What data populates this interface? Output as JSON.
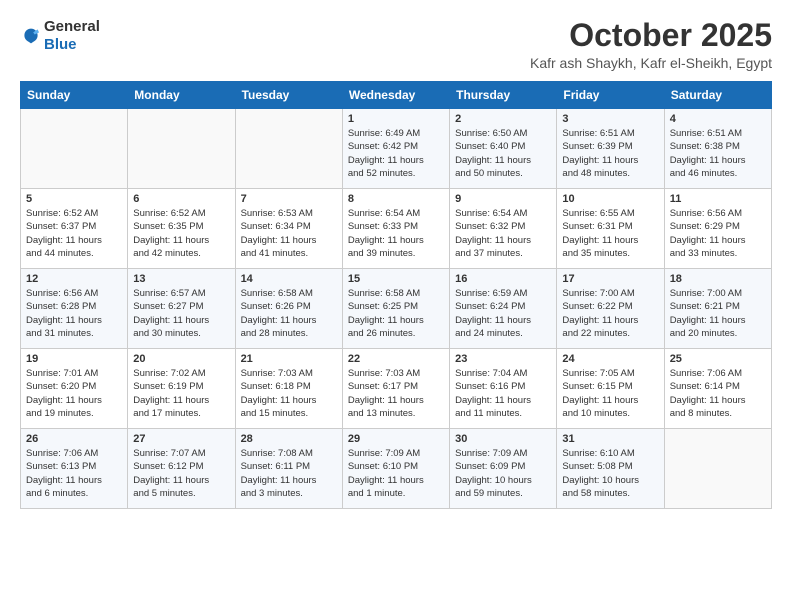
{
  "header": {
    "logo_general": "General",
    "logo_blue": "Blue",
    "month": "October 2025",
    "location": "Kafr ash Shaykh, Kafr el-Sheikh, Egypt"
  },
  "weekdays": [
    "Sunday",
    "Monday",
    "Tuesday",
    "Wednesday",
    "Thursday",
    "Friday",
    "Saturday"
  ],
  "weeks": [
    [
      {
        "day": "",
        "info": ""
      },
      {
        "day": "",
        "info": ""
      },
      {
        "day": "",
        "info": ""
      },
      {
        "day": "1",
        "info": "Sunrise: 6:49 AM\nSunset: 6:42 PM\nDaylight: 11 hours\nand 52 minutes."
      },
      {
        "day": "2",
        "info": "Sunrise: 6:50 AM\nSunset: 6:40 PM\nDaylight: 11 hours\nand 50 minutes."
      },
      {
        "day": "3",
        "info": "Sunrise: 6:51 AM\nSunset: 6:39 PM\nDaylight: 11 hours\nand 48 minutes."
      },
      {
        "day": "4",
        "info": "Sunrise: 6:51 AM\nSunset: 6:38 PM\nDaylight: 11 hours\nand 46 minutes."
      }
    ],
    [
      {
        "day": "5",
        "info": "Sunrise: 6:52 AM\nSunset: 6:37 PM\nDaylight: 11 hours\nand 44 minutes."
      },
      {
        "day": "6",
        "info": "Sunrise: 6:52 AM\nSunset: 6:35 PM\nDaylight: 11 hours\nand 42 minutes."
      },
      {
        "day": "7",
        "info": "Sunrise: 6:53 AM\nSunset: 6:34 PM\nDaylight: 11 hours\nand 41 minutes."
      },
      {
        "day": "8",
        "info": "Sunrise: 6:54 AM\nSunset: 6:33 PM\nDaylight: 11 hours\nand 39 minutes."
      },
      {
        "day": "9",
        "info": "Sunrise: 6:54 AM\nSunset: 6:32 PM\nDaylight: 11 hours\nand 37 minutes."
      },
      {
        "day": "10",
        "info": "Sunrise: 6:55 AM\nSunset: 6:31 PM\nDaylight: 11 hours\nand 35 minutes."
      },
      {
        "day": "11",
        "info": "Sunrise: 6:56 AM\nSunset: 6:29 PM\nDaylight: 11 hours\nand 33 minutes."
      }
    ],
    [
      {
        "day": "12",
        "info": "Sunrise: 6:56 AM\nSunset: 6:28 PM\nDaylight: 11 hours\nand 31 minutes."
      },
      {
        "day": "13",
        "info": "Sunrise: 6:57 AM\nSunset: 6:27 PM\nDaylight: 11 hours\nand 30 minutes."
      },
      {
        "day": "14",
        "info": "Sunrise: 6:58 AM\nSunset: 6:26 PM\nDaylight: 11 hours\nand 28 minutes."
      },
      {
        "day": "15",
        "info": "Sunrise: 6:58 AM\nSunset: 6:25 PM\nDaylight: 11 hours\nand 26 minutes."
      },
      {
        "day": "16",
        "info": "Sunrise: 6:59 AM\nSunset: 6:24 PM\nDaylight: 11 hours\nand 24 minutes."
      },
      {
        "day": "17",
        "info": "Sunrise: 7:00 AM\nSunset: 6:22 PM\nDaylight: 11 hours\nand 22 minutes."
      },
      {
        "day": "18",
        "info": "Sunrise: 7:00 AM\nSunset: 6:21 PM\nDaylight: 11 hours\nand 20 minutes."
      }
    ],
    [
      {
        "day": "19",
        "info": "Sunrise: 7:01 AM\nSunset: 6:20 PM\nDaylight: 11 hours\nand 19 minutes."
      },
      {
        "day": "20",
        "info": "Sunrise: 7:02 AM\nSunset: 6:19 PM\nDaylight: 11 hours\nand 17 minutes."
      },
      {
        "day": "21",
        "info": "Sunrise: 7:03 AM\nSunset: 6:18 PM\nDaylight: 11 hours\nand 15 minutes."
      },
      {
        "day": "22",
        "info": "Sunrise: 7:03 AM\nSunset: 6:17 PM\nDaylight: 11 hours\nand 13 minutes."
      },
      {
        "day": "23",
        "info": "Sunrise: 7:04 AM\nSunset: 6:16 PM\nDaylight: 11 hours\nand 11 minutes."
      },
      {
        "day": "24",
        "info": "Sunrise: 7:05 AM\nSunset: 6:15 PM\nDaylight: 11 hours\nand 10 minutes."
      },
      {
        "day": "25",
        "info": "Sunrise: 7:06 AM\nSunset: 6:14 PM\nDaylight: 11 hours\nand 8 minutes."
      }
    ],
    [
      {
        "day": "26",
        "info": "Sunrise: 7:06 AM\nSunset: 6:13 PM\nDaylight: 11 hours\nand 6 minutes."
      },
      {
        "day": "27",
        "info": "Sunrise: 7:07 AM\nSunset: 6:12 PM\nDaylight: 11 hours\nand 5 minutes."
      },
      {
        "day": "28",
        "info": "Sunrise: 7:08 AM\nSunset: 6:11 PM\nDaylight: 11 hours\nand 3 minutes."
      },
      {
        "day": "29",
        "info": "Sunrise: 7:09 AM\nSunset: 6:10 PM\nDaylight: 11 hours\nand 1 minute."
      },
      {
        "day": "30",
        "info": "Sunrise: 7:09 AM\nSunset: 6:09 PM\nDaylight: 10 hours\nand 59 minutes."
      },
      {
        "day": "31",
        "info": "Sunrise: 6:10 AM\nSunset: 5:08 PM\nDaylight: 10 hours\nand 58 minutes."
      },
      {
        "day": "",
        "info": ""
      }
    ]
  ]
}
